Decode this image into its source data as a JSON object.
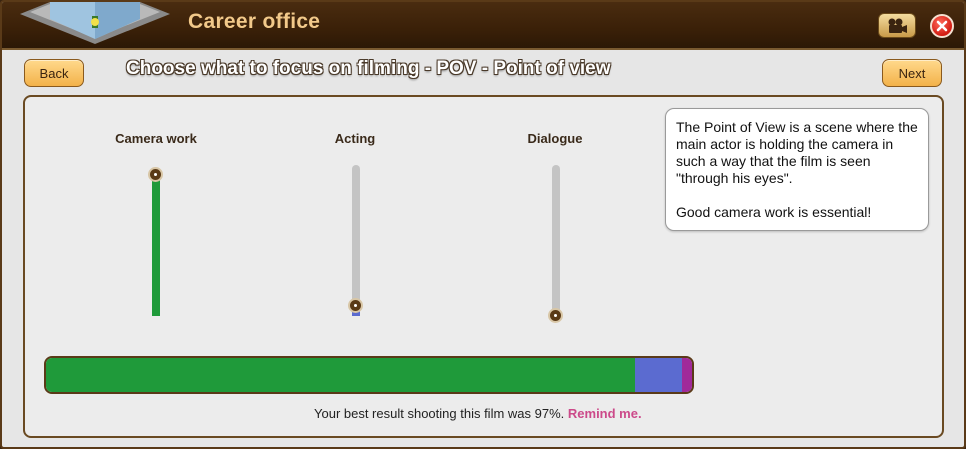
{
  "window": {
    "title": "Career office",
    "heading": "Choose what to focus on filming - POV - Point of view"
  },
  "nav": {
    "back_label": "Back",
    "next_label": "Next"
  },
  "icons": {
    "film": "film-camera-icon",
    "close": "close-icon",
    "building": "career-office-building-icon"
  },
  "sliders": [
    {
      "label": "Camera work",
      "value": 1.0,
      "color": "#1f9a3a"
    },
    {
      "label": "Acting",
      "value": 0.07,
      "color": "#5b6bd0"
    },
    {
      "label": "Dialogue",
      "value": 0.0,
      "color": "#a02a9a"
    }
  ],
  "info": {
    "paragraph1": "The Point of View is a scene where the main actor is holding the camera in such a way that the film is seen \"through his eyes\".",
    "paragraph2": "Good camera work is essential!"
  },
  "distribution": {
    "segments": [
      {
        "name": "Camera work",
        "fraction": 0.912,
        "color": "#1f9a3a"
      },
      {
        "name": "Acting",
        "fraction": 0.072,
        "color": "#5b6bd0"
      },
      {
        "name": "Dialogue",
        "fraction": 0.016,
        "color": "#a02a9a"
      }
    ]
  },
  "result": {
    "text": "Your best result shooting this film was 97%.",
    "link": "Remind me."
  },
  "colors": {
    "accent_button": "#f3b24a",
    "title_text": "#f2c98a",
    "link": "#cc4a8a"
  }
}
